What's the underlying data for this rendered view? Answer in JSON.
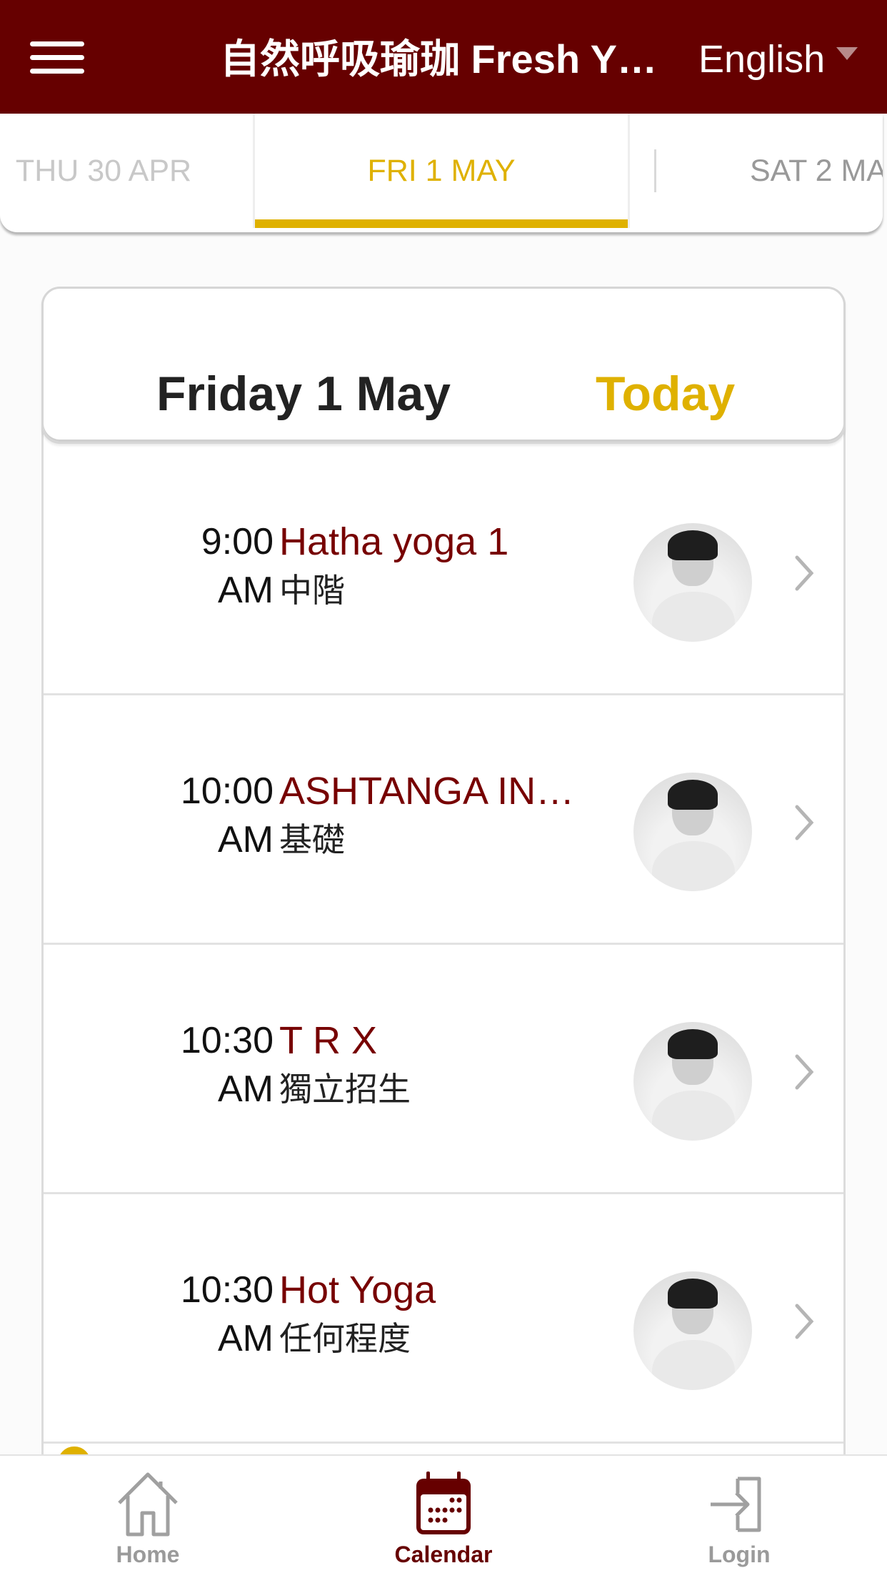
{
  "header": {
    "title": "自然呼吸瑜珈 Fresh Y…",
    "language": "English"
  },
  "date_tabs": {
    "previous": "THU 30 APR",
    "active": "FRI 1 MAY",
    "next": "SAT 2 MA"
  },
  "day_header": {
    "title": "Friday 1 May",
    "today_label": "Today"
  },
  "classes": [
    {
      "time": "9:00",
      "period": "AM",
      "name": "Hatha yoga 1",
      "level": "中階",
      "avatar": "instructor-photo"
    },
    {
      "time": "10:00",
      "period": "AM",
      "name": "ASHTANGA IN…",
      "level": "基礎",
      "avatar": "instructor-photo"
    },
    {
      "time": "10:30",
      "period": "AM",
      "name": "T R X",
      "level": "獨立招生",
      "avatar": "instructor-photo"
    },
    {
      "time": "10:30",
      "period": "AM",
      "name": "Hot Yoga",
      "level": "任何程度",
      "avatar": "instructor-photo"
    }
  ],
  "bottom_nav": {
    "items": [
      {
        "label": "Home",
        "icon": "home-icon",
        "active": false
      },
      {
        "label": "Calendar",
        "icon": "calendar-icon",
        "active": true
      },
      {
        "label": "Login",
        "icon": "login-icon",
        "active": false
      }
    ]
  },
  "colors": {
    "brand": "#660000",
    "accent": "#dfb100",
    "inactive": "#9a9a9a"
  }
}
